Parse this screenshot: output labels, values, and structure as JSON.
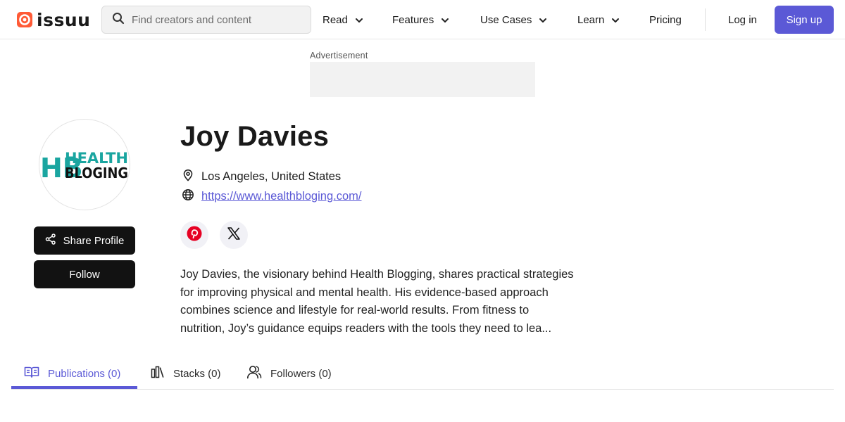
{
  "header": {
    "logo_text": "issuu",
    "search_placeholder": "Find creators and content",
    "nav": [
      {
        "label": "Read",
        "has_dropdown": true
      },
      {
        "label": "Features",
        "has_dropdown": true
      },
      {
        "label": "Use Cases",
        "has_dropdown": true
      },
      {
        "label": "Learn",
        "has_dropdown": true
      },
      {
        "label": "Pricing",
        "has_dropdown": false
      }
    ],
    "login_label": "Log in",
    "signup_label": "Sign up"
  },
  "ad": {
    "label": "Advertisement"
  },
  "profile": {
    "avatar_logo_letters": "HB",
    "avatar_logo_line1": "HEALTH",
    "avatar_logo_line2": "BLOGING",
    "share_label": "Share Profile",
    "follow_label": "Follow",
    "name": "Joy Davies",
    "location": "Los Angeles, United States",
    "website": "https://www.healthbloging.com/",
    "socials": [
      "pinterest-icon",
      "x-icon"
    ],
    "bio": "Joy Davies, the visionary behind Health Blogging, shares practical strategies for improving physical and mental health. His evidence-based approach combines science and lifestyle for real-world results. From fitness to nutrition, Joy’s guidance equips readers with the tools they need to lea..."
  },
  "tabs": [
    {
      "label": "Publications (0)",
      "icon": "book-open-icon",
      "active": true
    },
    {
      "label": "Stacks (0)",
      "icon": "stacks-icon",
      "active": false
    },
    {
      "label": "Followers (0)",
      "icon": "users-icon",
      "active": false
    }
  ],
  "colors": {
    "accent": "#5b59d6",
    "logo_red": "#ff5a36",
    "dark_button": "#121212",
    "teal_logo": "#1aa5a0",
    "pinterest": "#e60023"
  }
}
